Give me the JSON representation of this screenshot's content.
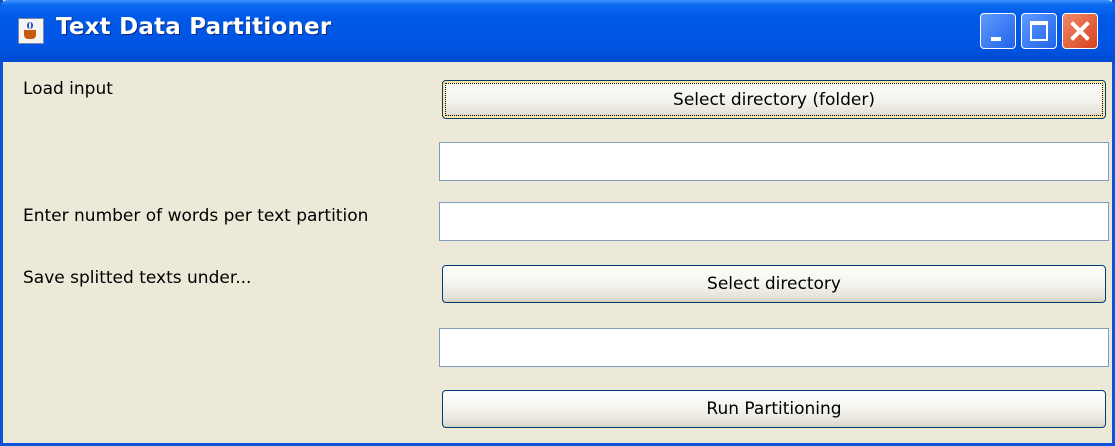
{
  "window": {
    "title": "Text Data Partitioner",
    "icon": "java-cup-icon",
    "controls": [
      "minimize-icon",
      "maximize-icon",
      "close-icon"
    ]
  },
  "form": {
    "load_input_label": "Load input",
    "select_input_button": "Select directory (folder)",
    "input_path_value": "",
    "words_label": "Enter number of words per text partition",
    "words_value": "",
    "save_label": "Save splitted texts under...",
    "select_output_button": "Select directory",
    "output_path_value": "",
    "run_button": "Run Partitioning"
  },
  "colors": {
    "titlebar": "#0058e6",
    "window_bg": "#ece9d8",
    "close_button": "#d8411e"
  }
}
